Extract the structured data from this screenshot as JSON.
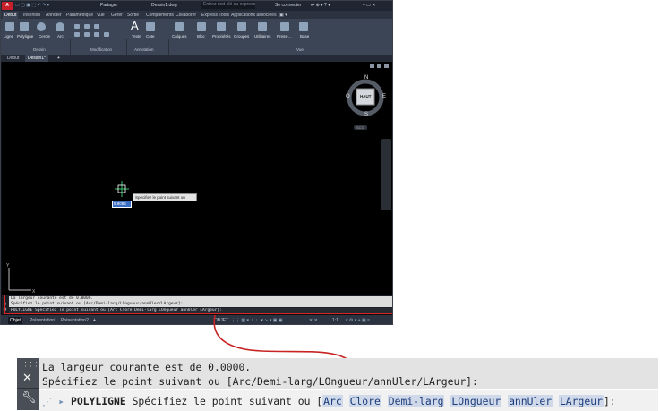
{
  "titlebar": {
    "logo": "A CAD",
    "share": "Partager",
    "doc_title": "Dessin1.dwg",
    "search_placeholder": "Entrez mot-clé ou expression",
    "login": "Se connecter"
  },
  "ribbon_tabs": [
    "Début",
    "Insertion",
    "Annoter",
    "Paramétrique",
    "Vue",
    "Gérer",
    "Sortie",
    "Compléments",
    "Collaborer",
    "Express Tools",
    "Applications associées"
  ],
  "ribbon": {
    "draw_tools": [
      "Ligne",
      "Polyligne",
      "Cercle",
      "Arc"
    ],
    "text_tools": [
      "Texte",
      "Cote"
    ],
    "panel_tools": [
      "Calques",
      "Bloc",
      "Propriétés",
      "Groupes",
      "Utilitaires",
      "Press-..."
    ],
    "base": "Base",
    "panels": [
      "Dessin",
      "Modification",
      "Annotation",
      "Vue"
    ]
  },
  "doc_tabs": [
    "Début",
    "Dessin1*"
  ],
  "viewcube": {
    "top_face": "HAUT",
    "north": "N",
    "south": "S",
    "east": "E",
    "west": "O",
    "wcs": "SCG"
  },
  "drawing": {
    "tooltip": "Spécifiez le point suivant ou",
    "dyn_input": "5.9066"
  },
  "command_small": {
    "history": [
      "La largeur courante est de 0.0000.",
      "Spécifiez le point suivant ou [Arc/Demi-larg/LOngueur/annUler/LArgeur]:"
    ],
    "current": "POLYLIGNE Spécifiez le point suivant ou [Arc Clore Demi-larg LOngueur annUler LArgeur]:"
  },
  "statusbar": {
    "layout_tabs": [
      "Objet",
      "Présentation1",
      "Présentation2"
    ],
    "model": "OBJET",
    "scale": "1:1"
  },
  "command_zoomed": {
    "history": [
      "La largeur courante est de 0.0000.",
      "Spécifiez le point suivant ou [Arc/Demi-larg/LOngueur/annUler/LArgeur]:"
    ],
    "command_name": "POLYLIGNE",
    "prompt": "Spécifiez le point suivant ou [",
    "options": [
      "Arc",
      "Clore",
      "Demi-larg",
      "LOngueur",
      "annUler",
      "LArgeur"
    ],
    "end": "]:"
  },
  "colors": {
    "highlight": "#dd2222",
    "app_dark": "#0d0f14",
    "ribbon": "#3b4556",
    "option_bg": "#cfd9ea"
  }
}
